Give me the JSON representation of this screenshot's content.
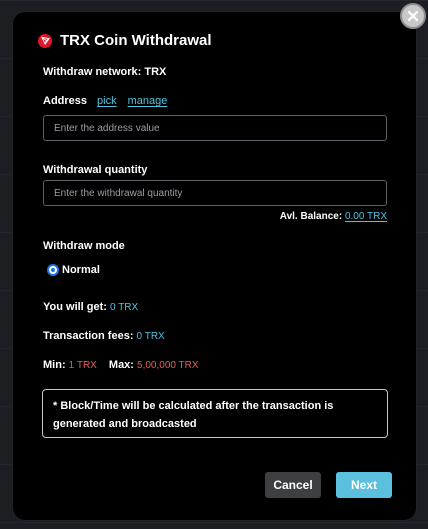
{
  "modal": {
    "title": "TRX Coin Withdrawal",
    "network_text": "Withdraw network: TRX",
    "address": {
      "label": "Address",
      "pick_link": "pick",
      "manage_link": "manage",
      "placeholder": "Enter the address value",
      "value": ""
    },
    "quantity": {
      "label": "Withdrawal quantity",
      "placeholder": "Enter the withdrawal quantity",
      "value": ""
    },
    "balance": {
      "label": "Avl. Balance:",
      "value": "0.00 TRX"
    },
    "mode": {
      "label": "Withdraw mode",
      "options": [
        "Normal"
      ],
      "selected": "Normal"
    },
    "receive": {
      "label": "You will get:",
      "value": "0 TRX"
    },
    "fees": {
      "label": "Transaction fees:",
      "value": "0 TRX"
    },
    "limits": {
      "min_label": "Min:",
      "min_value": "1 TRX",
      "max_label": "Max:",
      "max_value": "5,00,000 TRX"
    },
    "note": "* Block/Time will be calculated after the transaction is generated and broadcasted",
    "buttons": {
      "cancel": "Cancel",
      "next": "Next"
    },
    "icons": {
      "close": "close-icon",
      "logo": "trx-logo-icon"
    },
    "colors": {
      "accent": "#4fc3e0",
      "limit_red": "#e85a5a",
      "cancel_bg": "#3d3f43",
      "next_bg": "#5bc0de",
      "logo_red": "#e0162b"
    }
  }
}
